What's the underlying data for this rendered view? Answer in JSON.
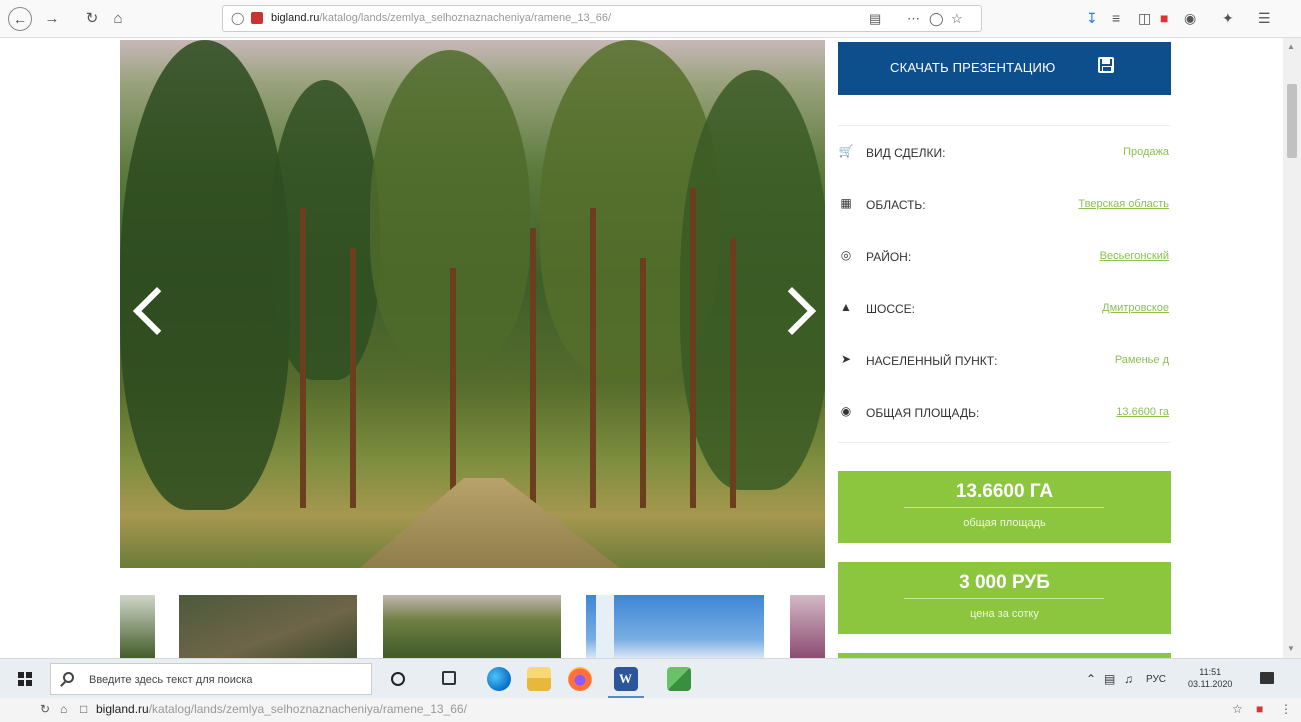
{
  "browser": {
    "url_domain": "bigland.ru",
    "url_path": "/katalog/lands/zemlya_selhoznaznacheniya/ramene_13_66/"
  },
  "download": {
    "label": "СКАЧАТЬ ПРЕЗЕНТАЦИЮ"
  },
  "details": [
    {
      "icon": "cart-icon",
      "label": "ВИД СДЕЛКИ:",
      "value": "Продажа",
      "link": false
    },
    {
      "icon": "map-icon",
      "label": "ОБЛАСТЬ:",
      "value": "Тверская область",
      "link": true
    },
    {
      "icon": "target-icon",
      "label": "РАЙОН:",
      "value": "Весьегонский",
      "link": true
    },
    {
      "icon": "road-icon",
      "label": "ШОССЕ:",
      "value": "Дмитровское",
      "link": true
    },
    {
      "icon": "location-arrow-icon",
      "label": "НАСЕЛЕННЫЙ ПУНКТ:",
      "value": "Раменье д",
      "link": false
    },
    {
      "icon": "globe-icon",
      "label": "ОБЩАЯ ПЛОЩАДЬ:",
      "value": "13.6600 га",
      "link": true
    }
  ],
  "stats": [
    {
      "value": "13.6600 ГА",
      "caption": "общая площадь"
    },
    {
      "value": "3 000 РУБ",
      "caption": "цена за сотку"
    }
  ],
  "taskbar": {
    "search_placeholder": "Введите здесь текст для поиска",
    "language": "РУС",
    "time": "11:51",
    "date": "03.11.2020"
  },
  "colors": {
    "download_bg": "#0d4e8d",
    "accent_green": "#8cc63e",
    "link_green": "#8cc152"
  }
}
